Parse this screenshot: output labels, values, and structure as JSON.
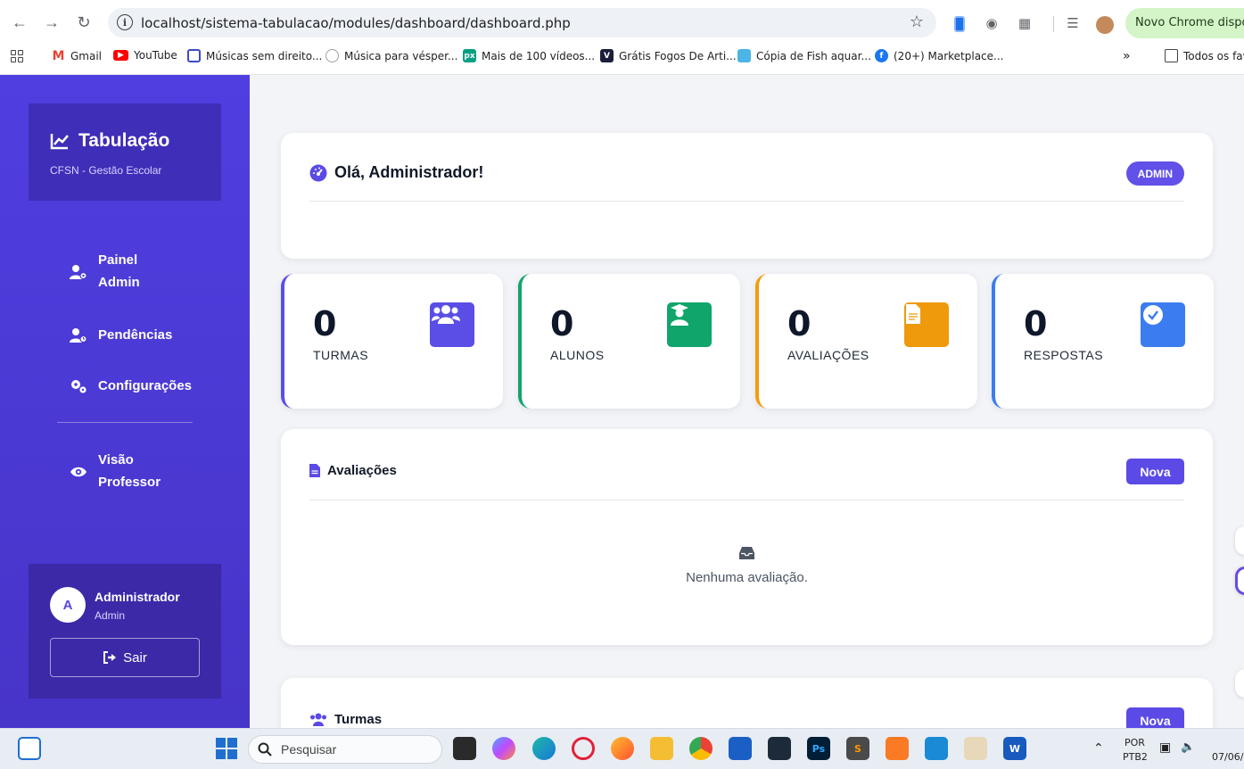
{
  "browser": {
    "url": "localhost/sistema-tabulacao/modules/dashboard/dashboard.php",
    "update_label": "Novo Chrome disponível",
    "bookmarks": [
      {
        "label": "Gmail"
      },
      {
        "label": "YouTube"
      },
      {
        "label": "Músicas sem direito..."
      },
      {
        "label": "Música para vésper..."
      },
      {
        "label": "Mais de 100 vídeos..."
      },
      {
        "label": "Grátis Fogos De Arti..."
      },
      {
        "label": "Cópia de Fish aquar..."
      },
      {
        "label": "(20+) Marketplace..."
      }
    ],
    "all_bookmarks": "Todos os favoritos"
  },
  "sidebar": {
    "brand": "Tabulação",
    "subtitle": "CFSN - Gestão Escolar",
    "items": [
      {
        "label_line1": "Painel",
        "label_line2": "Admin"
      },
      {
        "label": "Pendências"
      },
      {
        "label": "Configurações"
      },
      {
        "label_line1": "Visão",
        "label_line2": "Professor"
      }
    ],
    "user": {
      "initial": "A",
      "name": "Administrador",
      "role": "Admin",
      "logout": "Sair"
    }
  },
  "welcome": {
    "title": "Olá, Administrador!",
    "badge": "ADMIN"
  },
  "stats": [
    {
      "value": "0",
      "label": "TURMAS",
      "color": "#5b4ee6"
    },
    {
      "value": "0",
      "label": "ALUNOS",
      "color": "#10a56b"
    },
    {
      "value": "0",
      "label": "AVALIAÇÕES",
      "color": "#f29d0b"
    },
    {
      "value": "0",
      "label": "RESPOSTAS",
      "color": "#3b7cf0"
    }
  ],
  "avaliacoes": {
    "title": "Avaliações",
    "button": "Nova",
    "empty": "Nenhuma avaliação."
  },
  "turmas": {
    "title": "Turmas",
    "button": "Nova"
  },
  "taskbar": {
    "search_placeholder": "Pesquisar",
    "lang_line1": "POR",
    "lang_line2": "PTB2",
    "date": "07/06/"
  }
}
